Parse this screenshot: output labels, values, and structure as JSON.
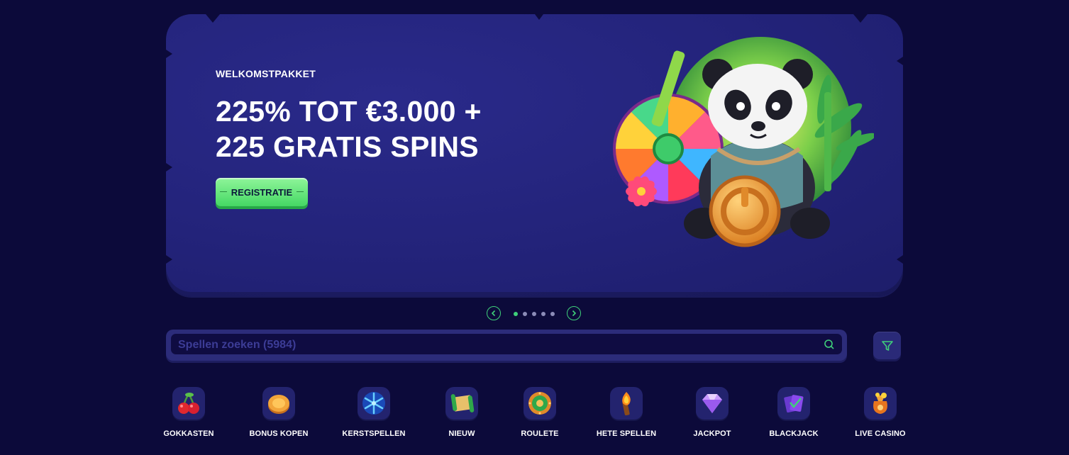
{
  "banner": {
    "eyebrow": "WELKOMSTPAKKET",
    "headline_line1": "225% TOT €3.000 +",
    "headline_line2": "225 GRATIS SPINS",
    "cta_label": "REGISTRATIE",
    "illustration": "panda-with-wheel-and-coin"
  },
  "carousel": {
    "prev_icon": "chevron-left-icon",
    "next_icon": "chevron-right-icon",
    "slide_count": 5,
    "active_index": 0
  },
  "search": {
    "placeholder": "Spellen zoeken (5984)",
    "icon": "search-icon"
  },
  "filter": {
    "icon": "filter-icon"
  },
  "categories": [
    {
      "label": "GOKKASTEN",
      "icon": "cherries-icon"
    },
    {
      "label": "BONUS KOPEN",
      "icon": "coin-icon"
    },
    {
      "label": "KERSTSPELLEN",
      "icon": "snowflake-icon"
    },
    {
      "label": "NIEUW",
      "icon": "scroll-icon"
    },
    {
      "label": "ROULETE",
      "icon": "roulette-icon"
    },
    {
      "label": "HETE SPELLEN",
      "icon": "torch-icon"
    },
    {
      "label": "JACKPOT",
      "icon": "diamond-icon"
    },
    {
      "label": "BLACKJACK",
      "icon": "cards-icon"
    },
    {
      "label": "LIVE CASINO",
      "icon": "money-bag-icon"
    }
  ],
  "colors": {
    "page_bg": "#0c0a3a",
    "banner_bg": "#25257c",
    "accent_green": "#3fd07a",
    "cta_green": "#5fe27a"
  }
}
